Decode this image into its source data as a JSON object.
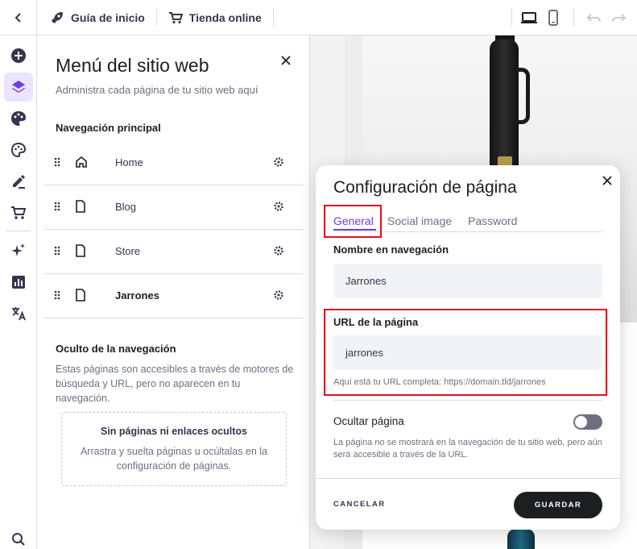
{
  "topbar": {
    "guide_label": "Guía de inicio",
    "store_label": "Tienda online"
  },
  "panel": {
    "title": "Menú del sitio web",
    "subtitle": "Administra cada página de tu sitio web aquí",
    "main_nav_heading": "Navegación principal",
    "items": [
      {
        "label": "Home",
        "icon": "home-icon"
      },
      {
        "label": "Blog",
        "icon": "page-icon"
      },
      {
        "label": "Store",
        "icon": "page-icon"
      },
      {
        "label": "Jarrones",
        "icon": "page-icon"
      }
    ],
    "hidden_heading": "Oculto de la navegación",
    "hidden_description": "Estas páginas son accesibles a través de motores de búsqueda y URL, pero no aparecen en tu navegación.",
    "empty_title": "Sin páginas ni enlaces ocultos",
    "empty_text": "Arrastra y suelta páginas u ocúltalas en la configuración de páginas."
  },
  "modal": {
    "title": "Configuración de página",
    "tabs": [
      "General",
      "Social image",
      "Password"
    ],
    "active_tab": "General",
    "nav_name_label": "Nombre en navegación",
    "nav_name_value": "Jarrones",
    "url_label": "URL de la página",
    "url_value": "jarrones",
    "url_help": "Aquí está tu URL completa: https://domain.tld/jarrones",
    "hide_label": "Ocultar página",
    "hide_enabled": false,
    "hide_help": "La página no se mostrará en la navegación de tu sitio web, pero aún será accesible a través de la URL.",
    "cancel_label": "CANCELAR",
    "save_label": "GUARDAR"
  },
  "colors": {
    "accent": "#673de6",
    "highlight": "#e0111f",
    "active_rail_bg": "#ebe4ff"
  }
}
